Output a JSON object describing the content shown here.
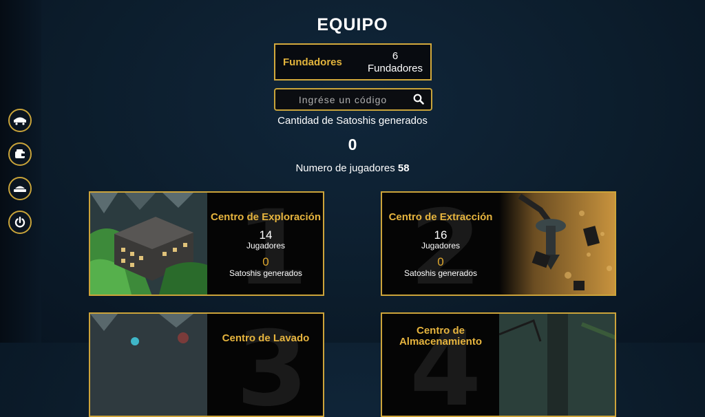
{
  "header": {
    "title": "EQUIPO"
  },
  "founders": {
    "label": "Fundadores",
    "count": "6",
    "unit": "Fundadores"
  },
  "search": {
    "placeholder": "Ingrése un código"
  },
  "stats": {
    "sats_label": "Cantidad de Satoshis generados",
    "sats_value": "0",
    "players_label": "Numero de jugadores",
    "players_value": "58"
  },
  "sidebar": {
    "items": [
      {
        "icon": "mine-cart-icon"
      },
      {
        "icon": "wallet-icon"
      },
      {
        "icon": "team-icon"
      },
      {
        "icon": "power-icon"
      }
    ]
  },
  "centers": [
    {
      "number": "1",
      "title": "Centro de Exploración",
      "players": "14",
      "players_label": "Jugadores",
      "sats": "0",
      "sats_label": "Satoshis generados"
    },
    {
      "number": "2",
      "title": "Centro de Extracción",
      "players": "16",
      "players_label": "Jugadores",
      "sats": "0",
      "sats_label": "Satoshis generados"
    },
    {
      "number": "3",
      "title": "Centro de Lavado"
    },
    {
      "number": "4",
      "title": "Centro de Almacenamiento"
    }
  ],
  "colors": {
    "accent": "#d4aa3c",
    "background": "#0c1d2c"
  }
}
